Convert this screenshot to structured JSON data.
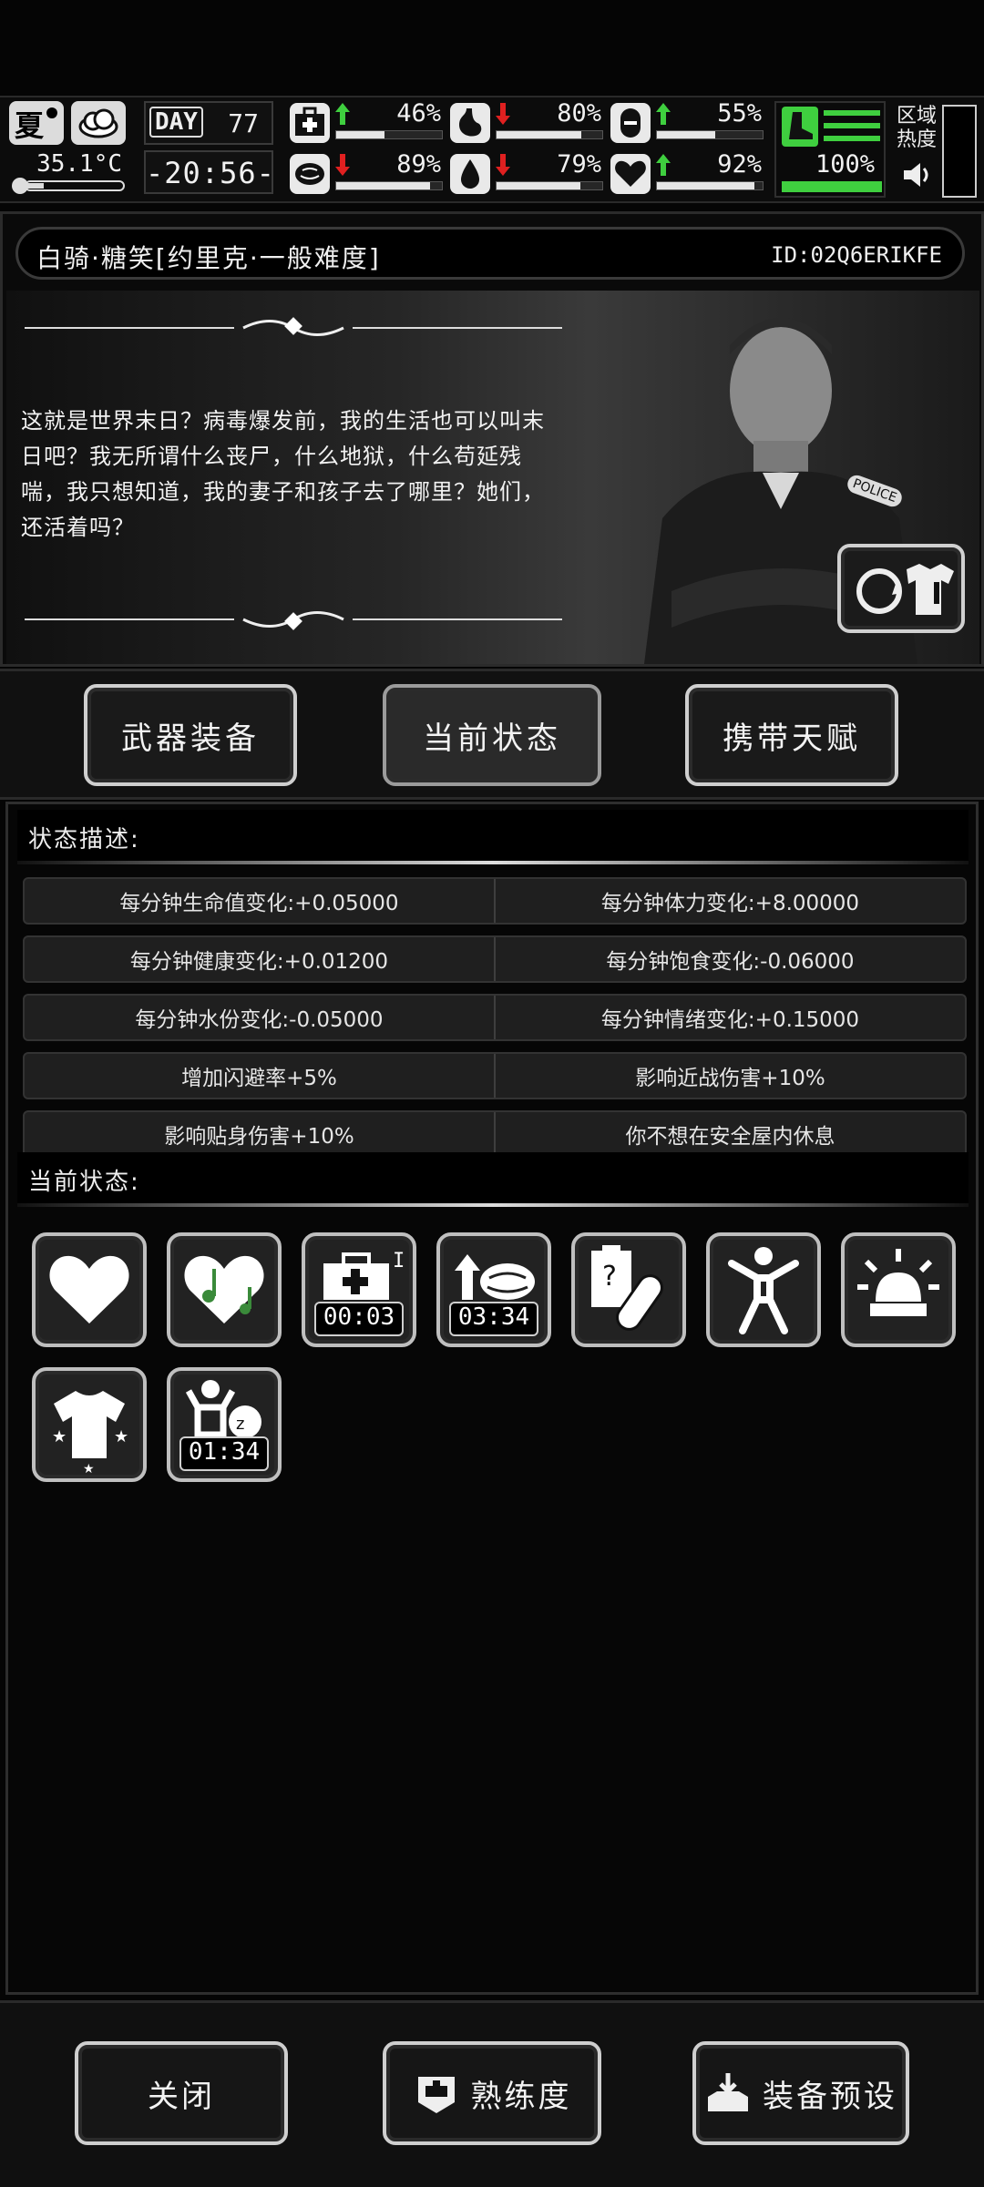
{
  "hud": {
    "season": "夏",
    "temperature": "35.1°C",
    "day_label": "DAY",
    "day_number": "77",
    "clock": "-20:56-",
    "stats": [
      {
        "id": "health",
        "trend": "up",
        "percent": "46%",
        "level": 0.46
      },
      {
        "id": "satiety",
        "trend": "down",
        "percent": "80%",
        "level": 0.8
      },
      {
        "id": "energy",
        "trend": "up",
        "percent": "55%",
        "level": 0.55
      },
      {
        "id": "brain",
        "trend": "down",
        "percent": "89%",
        "level": 0.89
      },
      {
        "id": "water",
        "trend": "down",
        "percent": "79%",
        "level": 0.79
      },
      {
        "id": "mood",
        "trend": "up",
        "percent": "92%",
        "level": 0.92
      }
    ],
    "stamina_percent": "100%",
    "zone_heat_label": "区域热度"
  },
  "character": {
    "name": "白骑·糖笑[约里克·一般难度]",
    "id_text": "ID:02Q6ERIKFE",
    "quote": "这就是世界末日？病毒爆发前，我的生活也可以叫末日吧？我无所谓什么丧尸，什么地狱，什么苟延残喘，我只想知道，我的妻子和孩子去了哪里？她们，还活着吗？",
    "badge_text": "POLICE"
  },
  "tabs": [
    {
      "label": "武器装备",
      "active": false
    },
    {
      "label": "当前状态",
      "active": true
    },
    {
      "label": "携带天赋",
      "active": false
    }
  ],
  "status": {
    "description_title": "状态描述:",
    "rows": [
      [
        "每分钟生命值变化:+0.05000",
        "每分钟体力变化:+8.00000"
      ],
      [
        "每分钟健康变化:+0.01200",
        "每分钟饱食变化:-0.06000"
      ],
      [
        "每分钟水份变化:-0.05000",
        "每分钟情绪变化:+0.15000"
      ],
      [
        "增加闪避率+5%",
        "影响近战伤害+10%"
      ],
      [
        "影响贴身伤害+10%",
        "你不想在安全屋内休息"
      ]
    ],
    "current_title": "当前状态:",
    "effects": [
      {
        "icon": "heart-icon",
        "timer": ""
      },
      {
        "icon": "music-heart-icon",
        "timer": ""
      },
      {
        "icon": "medkit-level-icon",
        "timer": "00:03"
      },
      {
        "icon": "brain-up-icon",
        "timer": "03:34"
      },
      {
        "icon": "medicine-pill-icon",
        "timer": ""
      },
      {
        "icon": "exercise-figure-icon",
        "timer": ""
      },
      {
        "icon": "alarm-siren-icon",
        "timer": ""
      },
      {
        "icon": "shirt-stars-icon",
        "timer": ""
      },
      {
        "icon": "sleep-person-icon",
        "timer": "01:34"
      }
    ]
  },
  "footer": {
    "close_label": "关闭",
    "proficiency_label": "熟练度",
    "preset_label": "装备预设"
  },
  "colors": {
    "background": "#050505",
    "panel": "#0b0b0b",
    "accent_green": "#3fcf3f",
    "arrow_red": "#e02020"
  }
}
